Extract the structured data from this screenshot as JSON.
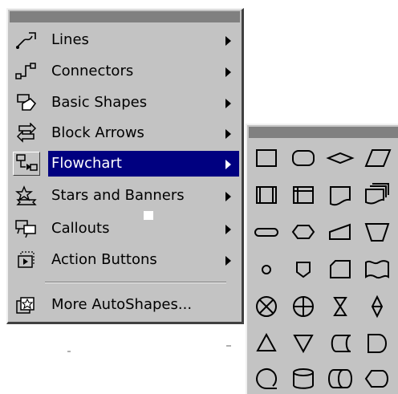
{
  "menu": {
    "items": [
      {
        "label": "Lines",
        "icon": "lines-icon",
        "has_submenu": true,
        "active": false
      },
      {
        "label": "Connectors",
        "icon": "connectors-icon",
        "has_submenu": true,
        "active": false
      },
      {
        "label": "Basic Shapes",
        "icon": "basic-shapes-icon",
        "has_submenu": true,
        "active": false
      },
      {
        "label": "Block Arrows",
        "icon": "block-arrows-icon",
        "has_submenu": true,
        "active": false
      },
      {
        "label": "Flowchart",
        "icon": "flowchart-icon",
        "has_submenu": true,
        "active": true
      },
      {
        "label": "Stars and Banners",
        "icon": "stars-banners-icon",
        "has_submenu": true,
        "active": false
      },
      {
        "label": "Callouts",
        "icon": "callouts-icon",
        "has_submenu": true,
        "active": false
      },
      {
        "label": "Action Buttons",
        "icon": "action-buttons-icon",
        "has_submenu": true,
        "active": false
      }
    ],
    "more": {
      "label": "More AutoShapes...",
      "icon": "more-autoshapes-icon"
    }
  },
  "flowchart_palette": {
    "shapes": [
      "process",
      "alternate-process",
      "decision",
      "data",
      "predefined-process",
      "internal-storage",
      "document",
      "multidocument",
      "terminator",
      "preparation",
      "manual-input",
      "manual-operation",
      "connector",
      "off-page-connector",
      "card",
      "punched-tape",
      "summing-junction",
      "or",
      "collate",
      "sort",
      "extract",
      "merge",
      "stored-data",
      "delay",
      "sequential-access-storage",
      "magnetic-disk",
      "direct-access-storage",
      "display"
    ]
  },
  "colors": {
    "menu_face": "#c3c3c3",
    "highlight": "#000080",
    "titlebar": "#808080"
  }
}
